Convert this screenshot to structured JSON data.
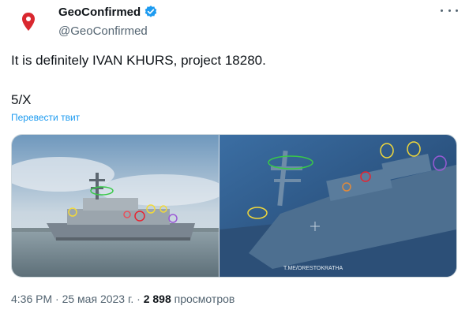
{
  "author": {
    "name": "GeoConfirmed",
    "handle": "@GeoConfirmed",
    "avatar_icon": "map-pin-icon",
    "verified": true
  },
  "tweet": {
    "text": "It is definitely IVAN KHURS, project 18280.",
    "part": "5/X",
    "translate_label": "Перевести твит"
  },
  "media": {
    "watermark": "T.ME/ORESTOKRATHA"
  },
  "meta": {
    "time": "4:36 PM",
    "separator1": " · ",
    "date": "25 мая 2023 г.",
    "separator2": " · ",
    "views": "2 898",
    "views_label": " просмотров"
  },
  "colors": {
    "accent": "#1d9bf0",
    "secondary_text": "#536471",
    "pin": "#e0245e"
  }
}
